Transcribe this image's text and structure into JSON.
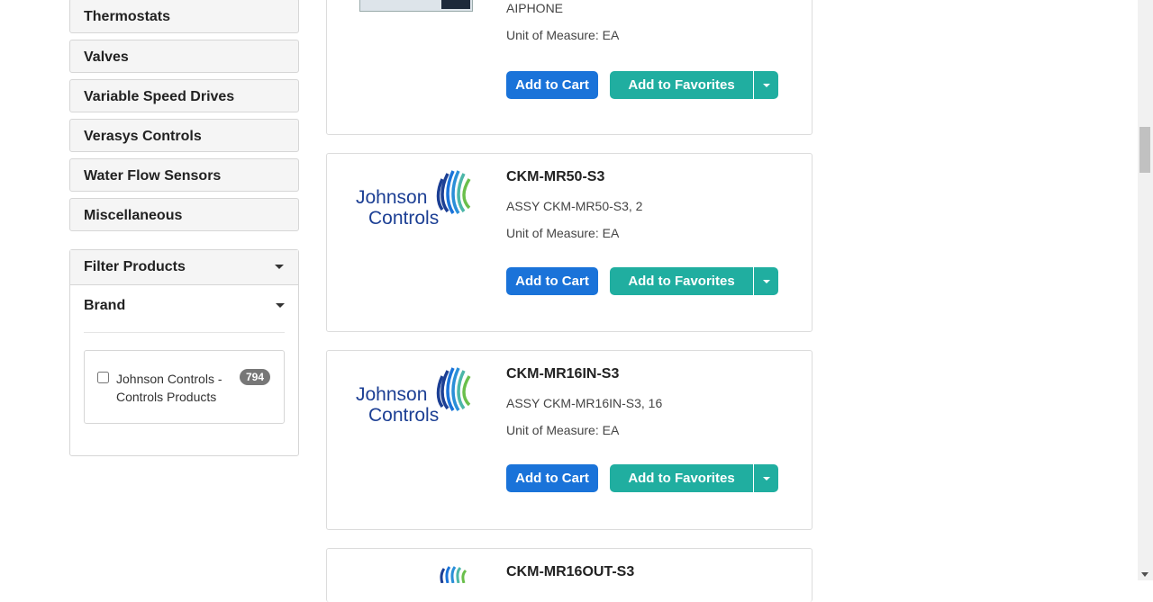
{
  "sidebar": {
    "categories": [
      "Thermostats",
      "Valves",
      "Variable Speed Drives",
      "Verasys Controls",
      "Water Flow Sensors",
      "Miscellaneous"
    ]
  },
  "filter": {
    "title": "Filter Products",
    "brand_label": "Brand",
    "facet": {
      "label": "Johnson Controls - Controls Products",
      "count": "794"
    }
  },
  "products": [
    {
      "name": "",
      "desc": "AIPHONE",
      "uom": "Unit of Measure: EA"
    },
    {
      "name": "CKM-MR50-S3",
      "desc": "ASSY CKM-MR50-S3, 2",
      "uom": "Unit of Measure: EA",
      "logo_line1": "Johnson",
      "logo_line2": "Controls"
    },
    {
      "name": "CKM-MR16IN-S3",
      "desc": "ASSY CKM-MR16IN-S3, 16",
      "uom": "Unit of Measure: EA",
      "logo_line1": "Johnson",
      "logo_line2": "Controls"
    },
    {
      "name": "CKM-MR16OUT-S3"
    }
  ],
  "buttons": {
    "add_to_cart": "Add to Cart",
    "add_to_favorites": "Add to Favorites"
  },
  "colors": {
    "cart": "#1a73d9",
    "favorites": "#20aea0",
    "logo_blue": "#1c3f94",
    "logo_green": "#6abf4b"
  }
}
